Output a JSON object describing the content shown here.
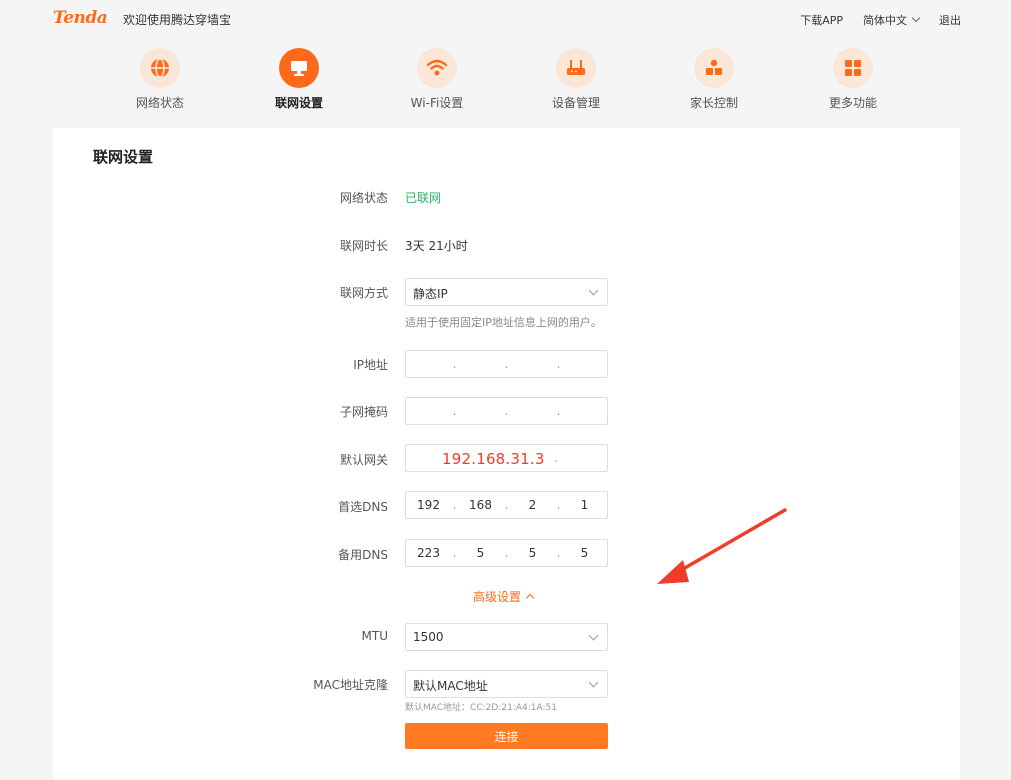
{
  "header": {
    "logo": "Tenda",
    "welcome": "欢迎使用腾达穿墙宝",
    "links": {
      "download": "下载APP",
      "language": "简体中文",
      "logout": "退出"
    }
  },
  "nav": [
    {
      "label": "网络状态",
      "icon": "globe-icon",
      "active": false
    },
    {
      "label": "联网设置",
      "icon": "monitor-icon",
      "active": true
    },
    {
      "label": "Wi-Fi设置",
      "icon": "wifi-icon",
      "active": false
    },
    {
      "label": "设备管理",
      "icon": "router-icon",
      "active": false
    },
    {
      "label": "家长控制",
      "icon": "parental-icon",
      "active": false
    },
    {
      "label": "更多功能",
      "icon": "grid-icon",
      "active": false
    }
  ],
  "colors": {
    "accent": "#ff6a1a",
    "status_ok": "#27b067",
    "annotation_red": "#f03c2b"
  },
  "form": {
    "title": "联网设置",
    "status": {
      "label": "网络状态",
      "value": "已联网"
    },
    "duration": {
      "label": "联网时长",
      "value": "3天 21小时"
    },
    "mode": {
      "label": "联网方式",
      "value": "静态IP",
      "hint": "适用于使用固定IP地址信息上网的用户。"
    },
    "ip": {
      "label": "IP地址",
      "octets": [
        "",
        "",
        "",
        ""
      ]
    },
    "mask": {
      "label": "子网掩码",
      "octets": [
        "",
        "",
        "",
        ""
      ]
    },
    "gateway": {
      "label": "默认网关",
      "value": "192.168.31.3"
    },
    "dns1": {
      "label": "首选DNS",
      "octets": [
        "192",
        "168",
        "2",
        "1"
      ]
    },
    "dns2": {
      "label": "备用DNS",
      "octets": [
        "223",
        "5",
        "5",
        "5"
      ]
    },
    "advanced": {
      "label": "高级设置"
    },
    "mtu": {
      "label": "MTU",
      "value": "1500"
    },
    "mac": {
      "label": "MAC地址克隆",
      "value": "默认MAC地址",
      "hint": "默认MAC地址：CC:2D:21:A4:1A:51"
    },
    "connect": "连接"
  }
}
